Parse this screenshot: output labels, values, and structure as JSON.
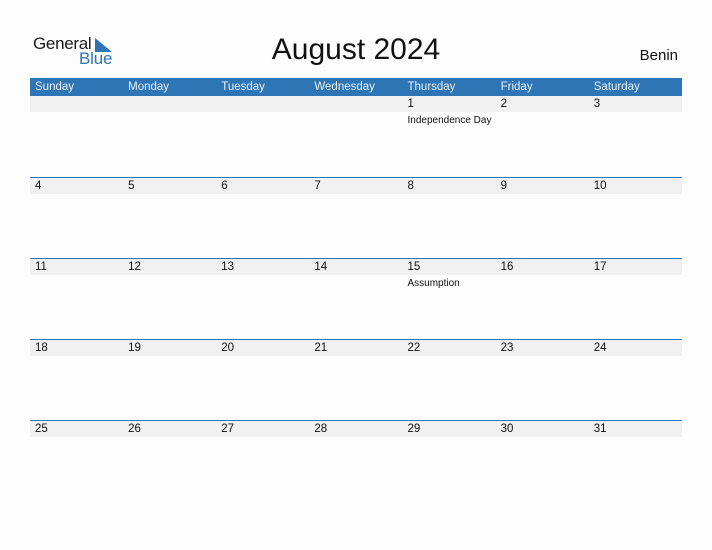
{
  "logo": {
    "part1": "General",
    "part2": "Blue",
    "icon": "triangle-icon"
  },
  "title": "August 2024",
  "country": "Benin",
  "colors": {
    "accent": "#2e75b6",
    "date_band": "#f0f0f0"
  },
  "days_of_week": [
    "Sunday",
    "Monday",
    "Tuesday",
    "Wednesday",
    "Thursday",
    "Friday",
    "Saturday"
  ],
  "weeks": [
    {
      "days": [
        {
          "date": "",
          "event": ""
        },
        {
          "date": "",
          "event": ""
        },
        {
          "date": "",
          "event": ""
        },
        {
          "date": "",
          "event": ""
        },
        {
          "date": "1",
          "event": "Independence Day"
        },
        {
          "date": "2",
          "event": ""
        },
        {
          "date": "3",
          "event": ""
        }
      ]
    },
    {
      "days": [
        {
          "date": "4",
          "event": ""
        },
        {
          "date": "5",
          "event": ""
        },
        {
          "date": "6",
          "event": ""
        },
        {
          "date": "7",
          "event": ""
        },
        {
          "date": "8",
          "event": ""
        },
        {
          "date": "9",
          "event": ""
        },
        {
          "date": "10",
          "event": ""
        }
      ]
    },
    {
      "days": [
        {
          "date": "11",
          "event": ""
        },
        {
          "date": "12",
          "event": ""
        },
        {
          "date": "13",
          "event": ""
        },
        {
          "date": "14",
          "event": ""
        },
        {
          "date": "15",
          "event": "Assumption"
        },
        {
          "date": "16",
          "event": ""
        },
        {
          "date": "17",
          "event": ""
        }
      ]
    },
    {
      "days": [
        {
          "date": "18",
          "event": ""
        },
        {
          "date": "19",
          "event": ""
        },
        {
          "date": "20",
          "event": ""
        },
        {
          "date": "21",
          "event": ""
        },
        {
          "date": "22",
          "event": ""
        },
        {
          "date": "23",
          "event": ""
        },
        {
          "date": "24",
          "event": ""
        }
      ]
    },
    {
      "days": [
        {
          "date": "25",
          "event": ""
        },
        {
          "date": "26",
          "event": ""
        },
        {
          "date": "27",
          "event": ""
        },
        {
          "date": "28",
          "event": ""
        },
        {
          "date": "29",
          "event": ""
        },
        {
          "date": "30",
          "event": ""
        },
        {
          "date": "31",
          "event": ""
        }
      ]
    }
  ]
}
